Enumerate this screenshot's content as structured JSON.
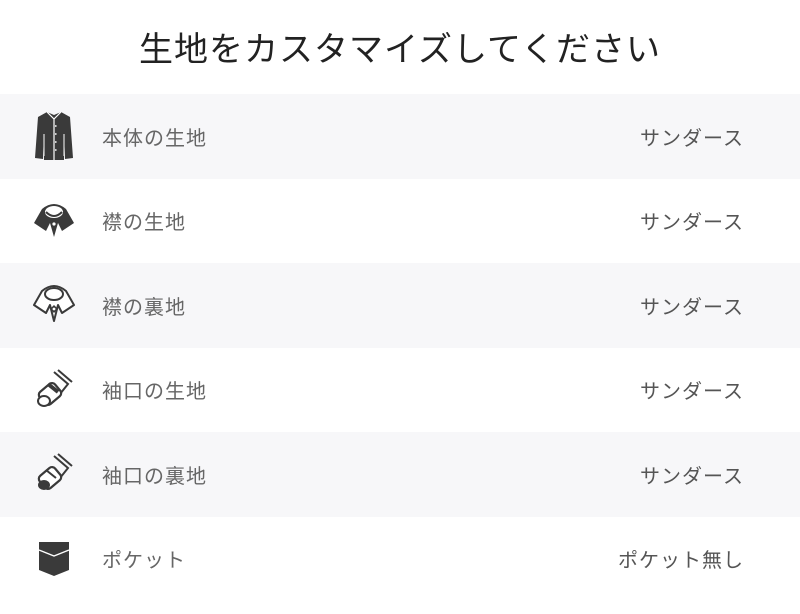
{
  "header": {
    "title": "生地をカスタマイズしてください"
  },
  "rows": [
    {
      "label": "本体の生地",
      "value": "サンダース",
      "icon": "shirt-body-icon"
    },
    {
      "label": "襟の生地",
      "value": "サンダース",
      "icon": "collar-icon"
    },
    {
      "label": "襟の裏地",
      "value": "サンダース",
      "icon": "collar-lining-icon"
    },
    {
      "label": "袖口の生地",
      "value": "サンダース",
      "icon": "cuff-icon"
    },
    {
      "label": "袖口の裏地",
      "value": "サンダース",
      "icon": "cuff-lining-icon"
    },
    {
      "label": "ポケット",
      "value": "ポケット無し",
      "icon": "pocket-icon"
    }
  ],
  "colors": {
    "row_shade": "#f7f7f9",
    "icon": "#3a3a3a",
    "label": "#666666",
    "value": "#555555"
  }
}
